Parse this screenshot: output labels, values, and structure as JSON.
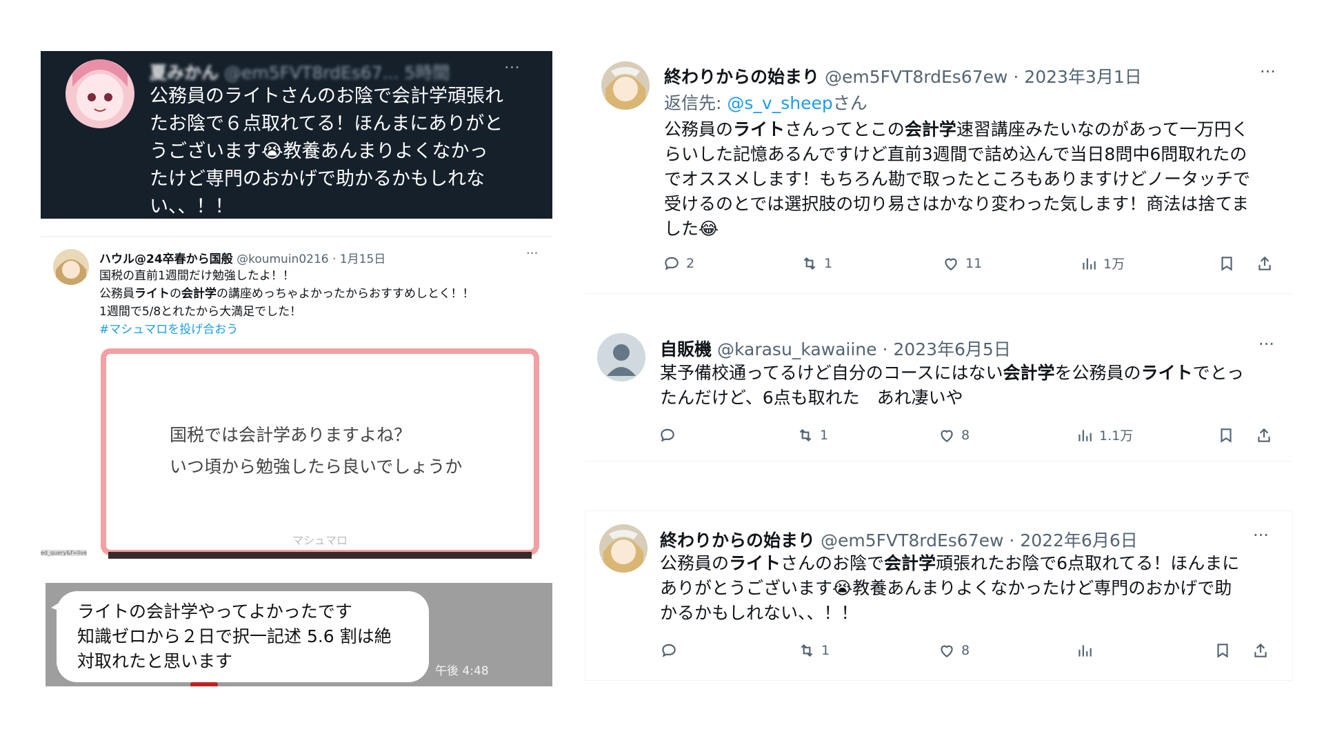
{
  "dark_tweet": {
    "name": "夏みかん",
    "handle": "@em5FVT8rdEs67...",
    "time": "5時間",
    "more": "···",
    "lines": [
      "公務員のライトさんのお陰で会計学頑張れ",
      "たお陰で６点取れてる！ほんまにありがと",
      "うございます😭教養あんまりよくなかっ",
      "たけど専門のおかげで助かるかもしれな",
      "い、、！！"
    ]
  },
  "mini_tweet": {
    "name": "ハウル@24卒春から国般",
    "handle": "@koumuin0216",
    "date": "· 1月15日",
    "more": "···",
    "line1": "国税の直前1週間だけ勉強したよ！！",
    "line2_a": "公務員",
    "line2_b": "ライト",
    "line2_c": "の",
    "line2_d": "会計学",
    "line2_e": "の講座めっちゃよかったからおすすめしとく！！",
    "line3": "1週間で5/8とれたから大満足でした！",
    "hashtag": "#マシュマロを投げ合おう",
    "card_q1": "国税では会計学ありますよね？",
    "card_q2": "いつ頃から勉強したら良いでしょうか",
    "card_brand": "マシュマロ",
    "url_snippet": "ed_query&f=live"
  },
  "line_message": {
    "lines": [
      "ライトの会計学やってよかったです",
      "知識ゼロから２日で択一記述 5.6 割は絶",
      "対取れたと思います"
    ],
    "time": "午後 4:48"
  },
  "tweet1": {
    "name": "終わりからの始まり",
    "handle": "@em5FVT8rdEs67ew",
    "date": "· 2023年3月1日",
    "more": "···",
    "reply_label": "返信先: ",
    "reply_to": "@s_v_sheep",
    "reply_suffix": "さん",
    "t1": "公務員の",
    "t2": "ライト",
    "t3": "さんってとこの",
    "t4": "会計学",
    "t5": "速習講座みたいなのがあって一万円く",
    "line2": "らいした記憶あるんですけど直前3週間で詰め込んで当日8問中6問取れたの",
    "line3": "でオススメします！もちろん勘で取ったところもありますけどノータッチで",
    "line4": "受けるのとでは選択肢の切り易さはかなり変わった気します！商法は捨てま",
    "line5": "した😂",
    "replies": "2",
    "retweets": "1",
    "likes": "11",
    "views": "1万"
  },
  "tweet2": {
    "name": "自販機",
    "handle": "@karasu_kawaiine",
    "date": "· 2023年6月5日",
    "more": "···",
    "t1": "某予備校通ってるけど自分のコースにはない",
    "t2": "会計学",
    "t3": "を公務員の",
    "t4": "ライト",
    "t5": "でとっ",
    "line2": "たんだけど、6点も取れた　あれ凄いや",
    "replies": "",
    "retweets": "1",
    "likes": "8",
    "views": "1.1万"
  },
  "tweet3": {
    "name": "終わりからの始まり",
    "handle": "@em5FVT8rdEs67ew",
    "date": "· 2022年6月6日",
    "more": "···",
    "t1": "公務員の",
    "t2": "ライト",
    "t3": "さんのお陰で",
    "t4": "会計学",
    "t5": "頑張れたお陰で6点取れてる！ほんまに",
    "line2": "ありがとうございます😭教養あんまりよくなかったけど専門のおかげで助",
    "line3": "かるかもしれない、、！！",
    "replies": "",
    "retweets": "1",
    "likes": "8",
    "views": ""
  },
  "colors": {
    "dark_bg": "#15202b",
    "link": "#1d9bf0",
    "muted": "#536471",
    "card_border": "#f2a0a3",
    "chat_bg": "#9e9e9e"
  }
}
